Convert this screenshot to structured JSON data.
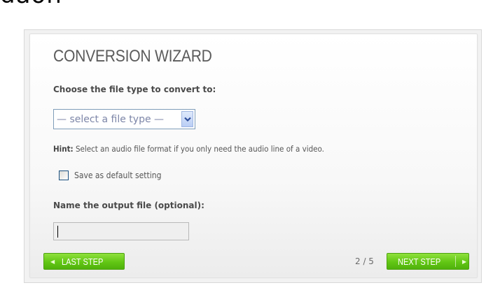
{
  "top_fragment": "daon",
  "wizard": {
    "title": "CONVERSION WIZARD",
    "file_type_label": "Choose the file type to convert to:",
    "file_type_select": {
      "selected": "— select a file type —"
    },
    "hint_prefix": "Hint:",
    "hint_text": " Select an audio file format if you only need the audio line of a video.",
    "save_default": {
      "label": "Save as default setting",
      "checked": false
    },
    "output_name_label": "Name the output file (optional):",
    "output_name_value": "",
    "last_step_label": "LAST STEP",
    "next_step_label": "NEXT STEP",
    "step_indicator": "2 / 5"
  },
  "icons": {
    "last_step": "triangle-left-icon",
    "next_step": "triangle-right-icon",
    "dropdown": "chevron-down-icon"
  },
  "colors": {
    "button_green": "#62c614",
    "title_gray": "#5b5b5b",
    "select_text": "#7d86a8"
  }
}
